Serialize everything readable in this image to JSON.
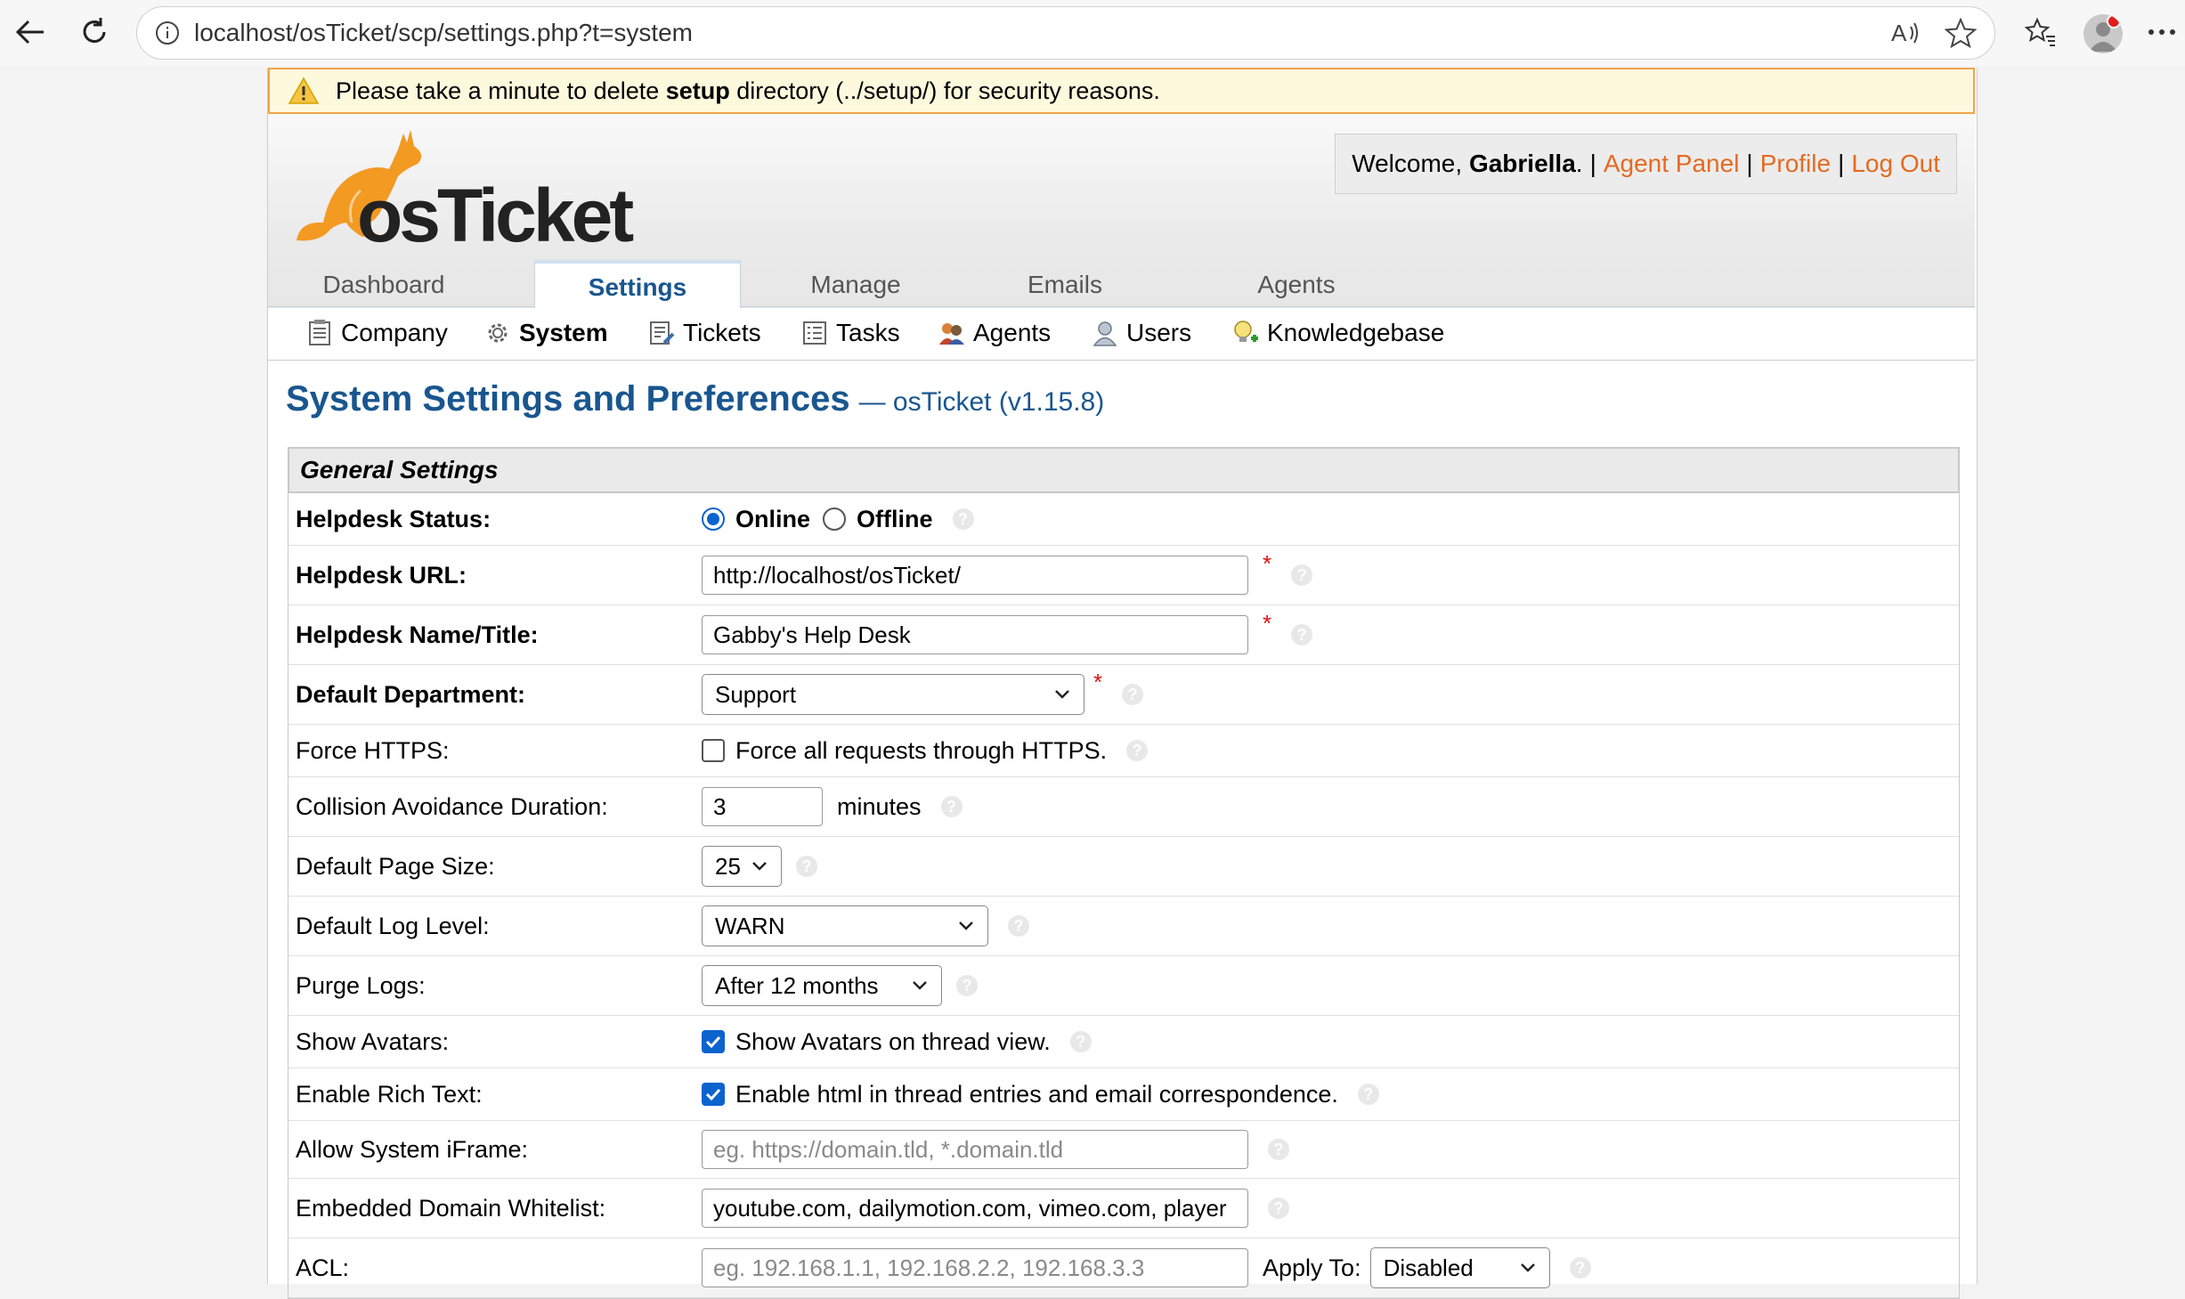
{
  "browser": {
    "url": "localhost/osTicket/scp/settings.php?t=system"
  },
  "warning": {
    "prefix": "Please take a minute to delete ",
    "bold": "setup",
    "suffix": " directory (../setup/) for security reasons."
  },
  "header": {
    "logo_text": "osTicket",
    "welcome_prefix": "Welcome, ",
    "user": "Gabriella",
    "welcome_dot": ".",
    "links": [
      "Agent Panel",
      "Profile",
      "Log Out"
    ]
  },
  "tabs": [
    "Dashboard",
    "Settings",
    "Manage",
    "Emails",
    "Agents"
  ],
  "active_tab": "Settings",
  "subnav": [
    "Company",
    "System",
    "Tickets",
    "Tasks",
    "Agents",
    "Users",
    "Knowledgebase"
  ],
  "active_subnav": "System",
  "page": {
    "title": "System Settings and Preferences",
    "version": "— osTicket (v1.15.8)"
  },
  "section": "General Settings",
  "fields": {
    "helpdesk_status": {
      "label": "Helpdesk Status:",
      "options": [
        "Online",
        "Offline"
      ],
      "selected": "Online"
    },
    "helpdesk_url": {
      "label": "Helpdesk URL:",
      "value": "http://localhost/osTicket/"
    },
    "helpdesk_name": {
      "label": "Helpdesk Name/Title:",
      "value": "Gabby's Help Desk"
    },
    "default_department": {
      "label": "Default Department:",
      "value": "Support"
    },
    "force_https": {
      "label": "Force HTTPS:",
      "text": "Force all requests through HTTPS.",
      "checked": false
    },
    "collision": {
      "label": "Collision Avoidance Duration:",
      "value": "3",
      "unit": "minutes"
    },
    "page_size": {
      "label": "Default Page Size:",
      "value": "25"
    },
    "log_level": {
      "label": "Default Log Level:",
      "value": "WARN"
    },
    "purge_logs": {
      "label": "Purge Logs:",
      "value": "After 12 months"
    },
    "show_avatars": {
      "label": "Show Avatars:",
      "text": "Show Avatars on thread view.",
      "checked": true
    },
    "rich_text": {
      "label": "Enable Rich Text:",
      "text": "Enable html in thread entries and email correspondence.",
      "checked": true
    },
    "iframe": {
      "label": "Allow System iFrame:",
      "placeholder": "eg. https://domain.tld, *.domain.tld"
    },
    "whitelist": {
      "label": "Embedded Domain Whitelist:",
      "value": "youtube.com, dailymotion.com, vimeo.com, player"
    },
    "acl": {
      "label": "ACL:",
      "placeholder": "eg. 192.168.1.1, 192.168.2.2, 192.168.3.3",
      "apply_label": "Apply To:",
      "apply_value": "Disabled"
    }
  },
  "colors": {
    "accent_blue": "#19568f",
    "link_orange": "#e46a21",
    "warning_bg": "#fdf9dd",
    "warning_border": "#f0a44a",
    "checkbox_blue": "#0b63ce"
  }
}
